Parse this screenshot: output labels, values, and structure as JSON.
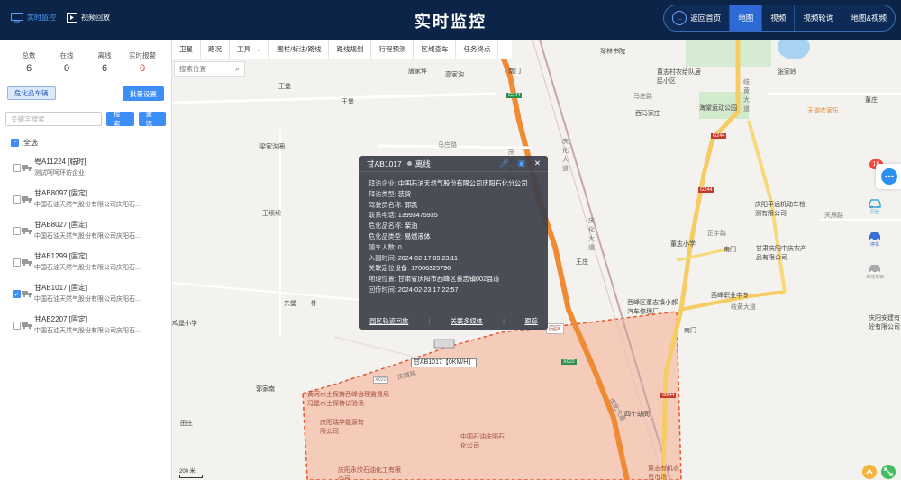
{
  "header": {
    "tabs": [
      {
        "label": "实时监控",
        "icon": "monitor-icon",
        "active": true
      },
      {
        "label": "视频回放",
        "icon": "play-icon",
        "active": false
      }
    ],
    "title": "实时监控",
    "nav": [
      {
        "label": "返回首页",
        "active": false
      },
      {
        "label": "地图",
        "active": true
      },
      {
        "label": "视频",
        "active": false
      },
      {
        "label": "视频轮询",
        "active": false
      },
      {
        "label": "地图&视频",
        "active": false
      }
    ]
  },
  "sidebar": {
    "stats": [
      {
        "label": "总数",
        "value": "6"
      },
      {
        "label": "在线",
        "value": "0"
      },
      {
        "label": "离线",
        "value": "6"
      },
      {
        "label": "实时报警",
        "value": "0",
        "color": "#e23b3b"
      }
    ],
    "filter_chip": "危化品车辆",
    "batch_button": "批量设置",
    "keyword_placeholder": "关键字搜索",
    "search_button": "搜索",
    "reset_button": "重选",
    "select_all": "全选",
    "vehicles": [
      {
        "name": "粤A11224 [临时]",
        "company": "测试呵呵环访企业",
        "checked": false
      },
      {
        "name": "甘AB8097 [固定]",
        "company": "中国石油天然气股份有限公司庆阳石...",
        "checked": false
      },
      {
        "name": "甘AB8027 [固定]",
        "company": "中国石油天然气股份有限公司庆阳石...",
        "checked": false
      },
      {
        "name": "甘AB1299 [固定]",
        "company": "中国石油天然气股份有限公司庆阳石...",
        "checked": false
      },
      {
        "name": "甘AB1017 [固定]",
        "company": "中国石油天然气股份有限公司庆阳石...",
        "checked": true
      },
      {
        "name": "甘AB2207 [固定]",
        "company": "中国石油天然气股份有限公司庆阳石...",
        "checked": false
      }
    ]
  },
  "map": {
    "toolbar": [
      "卫星",
      "路况",
      "工具",
      "围栏/标注/路线",
      "路线规划",
      "行程预测",
      "区域查车",
      "任务终点"
    ],
    "search_placeholder": "搜索位置",
    "labels": {
      "l1": "琴林书院",
      "l2": "董志村农给队居民小区",
      "l3": "海棠运动公园",
      "l4": "岐黄大道",
      "l5": "天湖农家乐",
      "l6": "西马家庄",
      "l7": "马庄路",
      "l8": "庆阳平远机动车检测有限公司",
      "l9": "天辰路",
      "l10": "董志小学",
      "l11": "正宇路",
      "l12": "甘肃庆阳中庆农产品有限公司",
      "l13": "西峰职业中专",
      "l14": "西峰区董志镇小郝汽车修理厂",
      "l15": "岐黄大道",
      "l16": "庆阳安建有砼有限公司",
      "l17": "马庄路",
      "l18": "庆化大道",
      "l19": "庆化大道",
      "l20": "王堡",
      "l21": "梁家沟圈",
      "l22": "王坝坝",
      "l23": "鸡堡小学",
      "l24": "东堡",
      "l25": "田庄",
      "l26": "黄河水土保持西峰治理监督局冯堡水土保持试验场",
      "l27": "庆阳瑞华能源有限公司",
      "l28": "中国石油庆阳石化公司",
      "l29": "庆阳永欣石油化工有限公司",
      "l30": "四个胡同",
      "l31": "南门",
      "l32": "园区",
      "l33": "王庄",
      "l34": "唐家坪",
      "l35": "南门",
      "l36": "庆化大道",
      "l37": "张家岭",
      "l38": "董庄",
      "l39": "高家沟",
      "l40": "王堡",
      "l41": "庆化大道",
      "l42": "郭家南",
      "l43": "南门",
      "l44": "朴",
      "l45": "董志有机农贸市场",
      "l46": "庆城路"
    },
    "road_codes": [
      "G244",
      "G244",
      "G244",
      "G244",
      "X022",
      "X022"
    ],
    "scale": "200 米",
    "side_badge": "16",
    "side_icons": [
      "行驶",
      "停车",
      "离线车辆"
    ],
    "car_label": "甘AB1017【0KM/H】"
  },
  "popup": {
    "plate": "甘AB1017",
    "status": "离线",
    "rows": [
      {
        "k": "拜访企业:",
        "v": "中国石油天然气股份有限公司庆阳石化分公司"
      },
      {
        "k": "拜访类型:",
        "v": "装货"
      },
      {
        "k": "驾驶员名称:",
        "v": "郭凯"
      },
      {
        "k": "联系电话:",
        "v": "13993475935"
      },
      {
        "k": "危化品名称:",
        "v": "柴油"
      },
      {
        "k": "危化品类型:",
        "v": "易燃液体"
      },
      {
        "k": "随车人数:",
        "v": "0"
      },
      {
        "k": "入园时间:",
        "v": "2024-02-17 09:23:11"
      },
      {
        "k": "关联定位设备:",
        "v": "17006325796"
      },
      {
        "k": "地理位置:",
        "v": "甘肃省庆阳市西峰区董志镇002县道"
      },
      {
        "k": "回传时间:",
        "v": "2024-02-23 17:22:57"
      }
    ],
    "footer": [
      "园区轨迹回放",
      "关联多媒体",
      "跟踪"
    ]
  }
}
